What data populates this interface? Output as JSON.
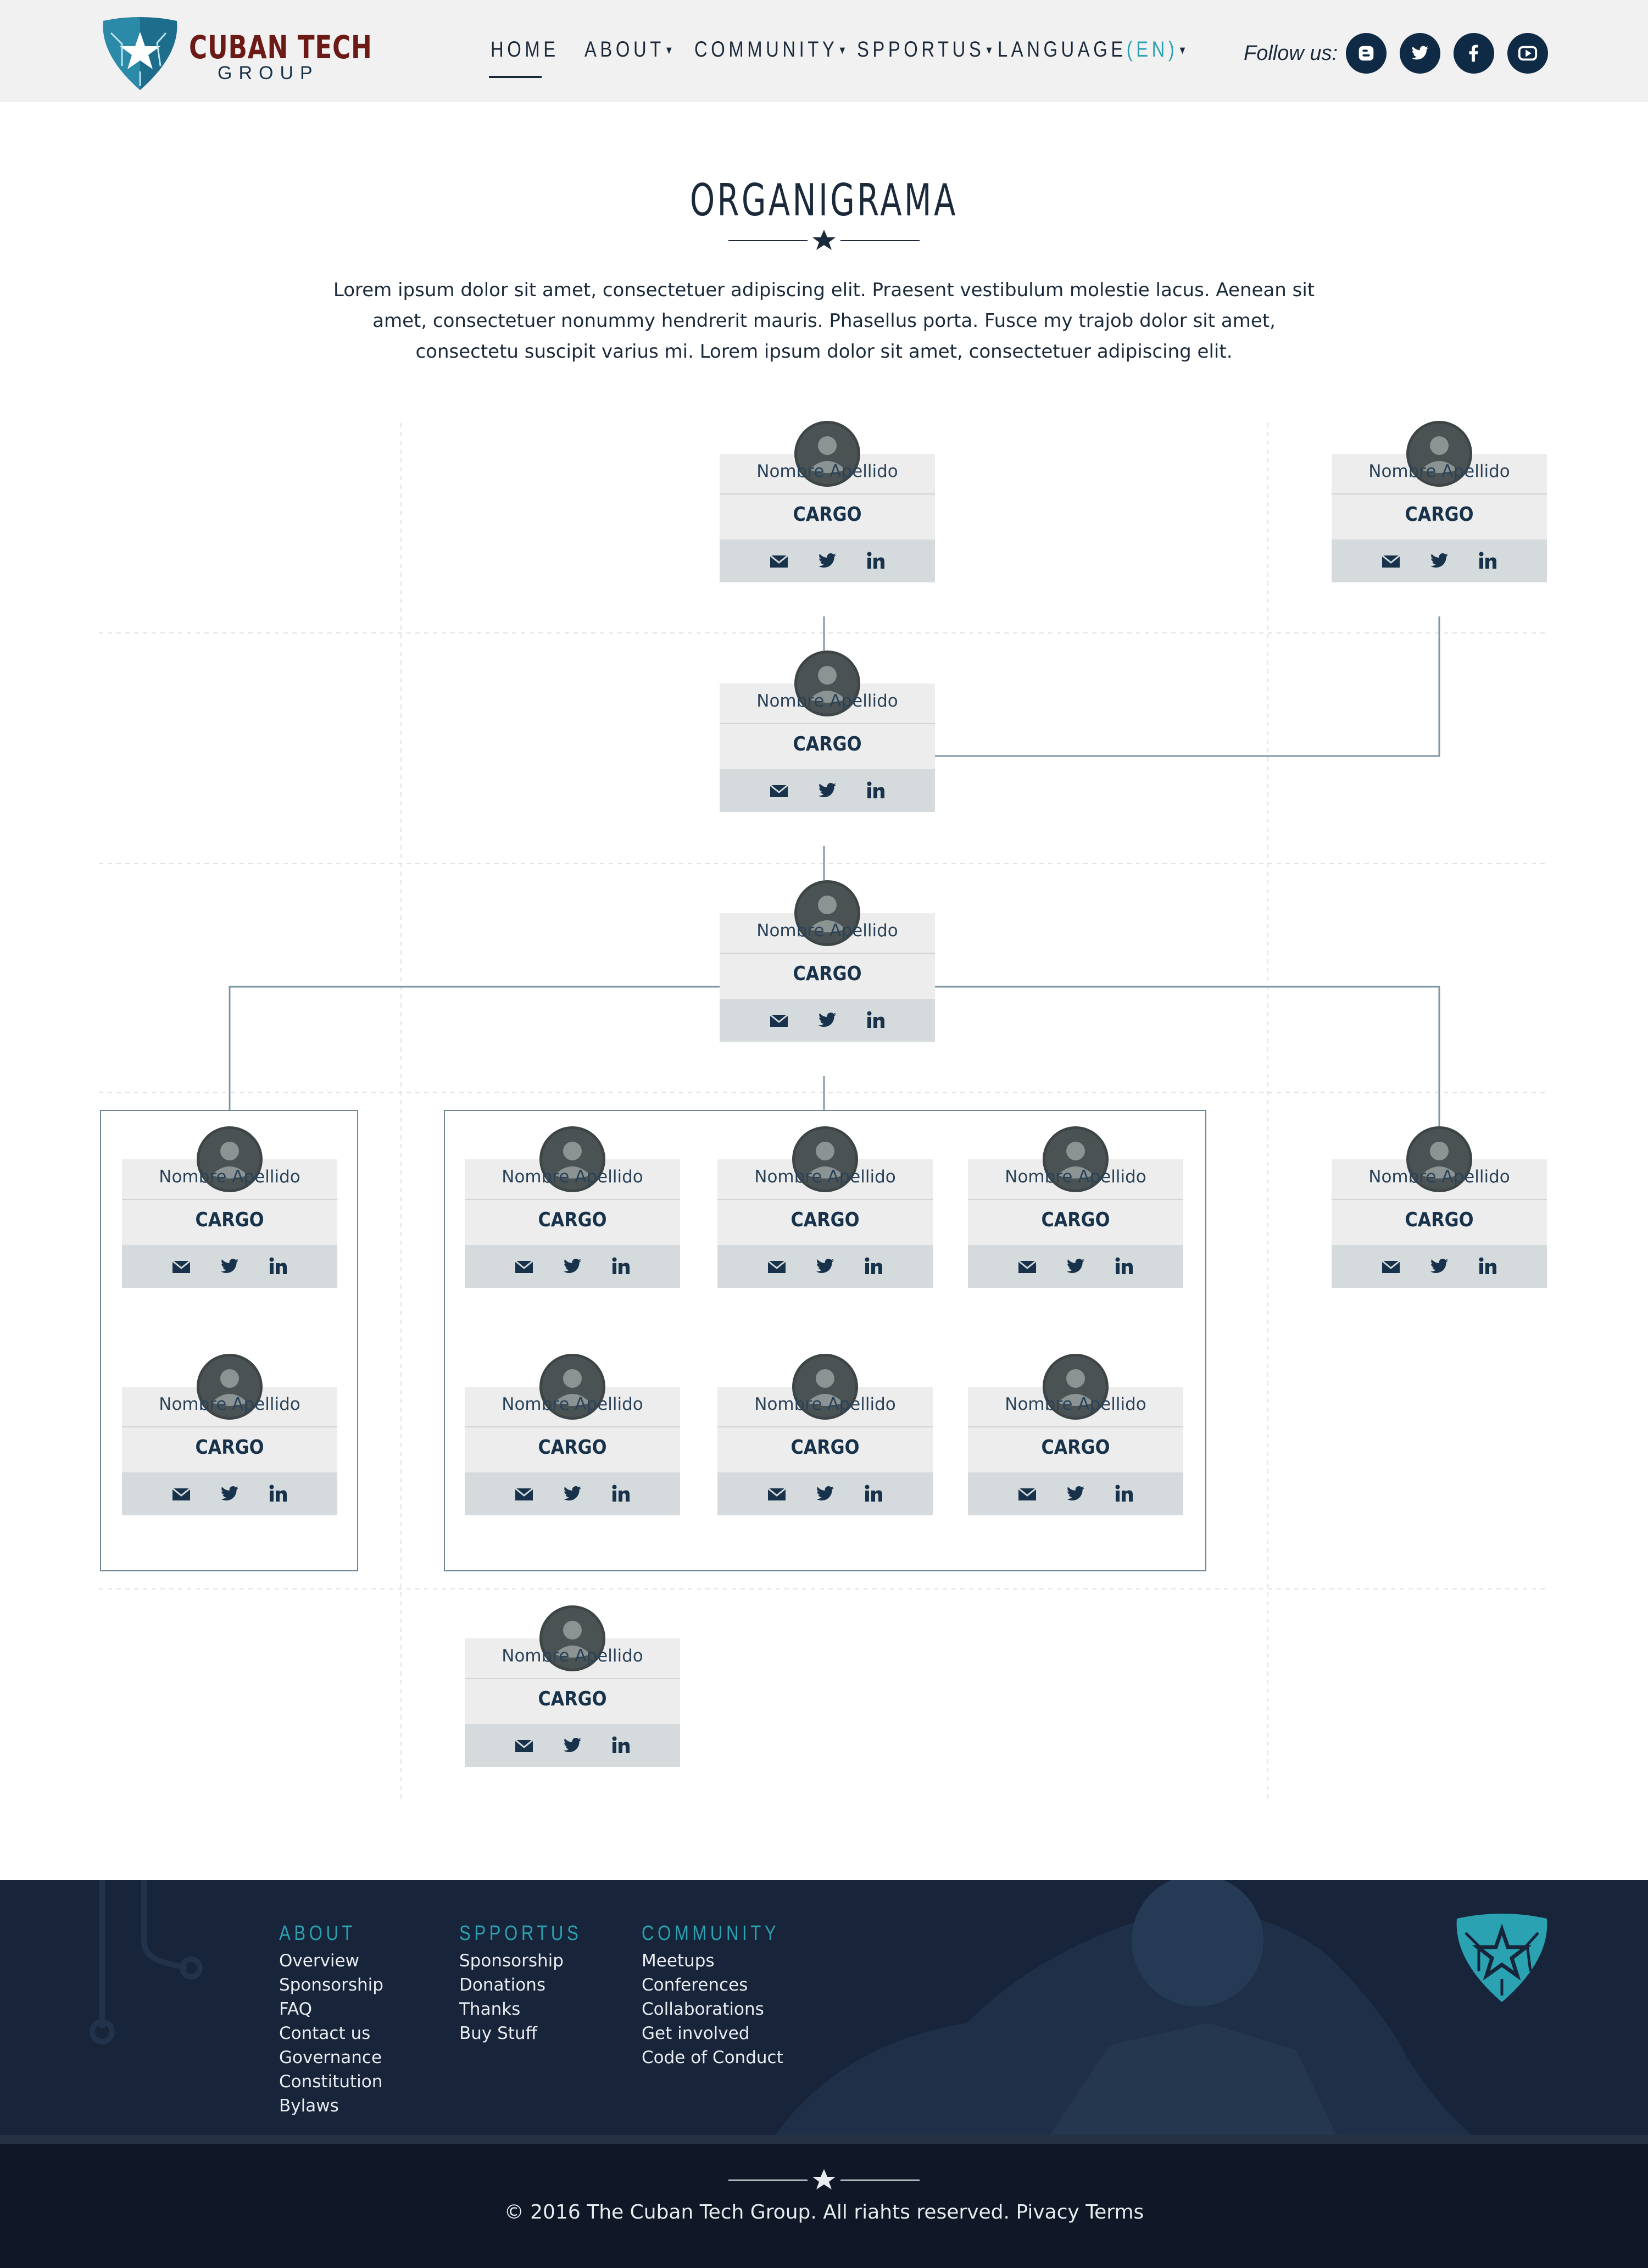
{
  "brand": {
    "name": "CUBAN TECH",
    "sub": "GROUP",
    "colors": {
      "navy": "#0f2a44",
      "teal": "#2aa2b2",
      "maroon": "#6b1a16",
      "footer": "#17243a"
    }
  },
  "nav": {
    "items": [
      {
        "label": "HOME",
        "active": true
      },
      {
        "label": "ABOUT",
        "dropdown": true
      },
      {
        "label": "COMMUNITY",
        "dropdown": true
      },
      {
        "label": "SPPORTUS",
        "dropdown": true
      }
    ],
    "language": {
      "label": "LANGUAGE",
      "code": "(EN)",
      "dropdown": true
    },
    "follow_label": "Follow us:",
    "social": [
      "blogger-icon",
      "twitter-icon",
      "facebook-icon",
      "youtube-icon"
    ]
  },
  "page": {
    "title": "ORGANIGRAMA",
    "intro": "Lorem ipsum dolor sit amet, consectetuer adipiscing elit. Praesent vestibulum molestie lacus. Aenean sit amet, consectetuer nonummy hendrerit  mauris. Phasellus porta. Fusce my trajob dolor sit amet, consectetu suscipit varius mi. Lorem ipsum dolor sit amet, consectetuer adipiscing elit."
  },
  "org": {
    "members": [
      {
        "name": "Nombre Apellido",
        "role": "CARGO"
      },
      {
        "name": "Nombre Apellido",
        "role": "CARGO"
      },
      {
        "name": "Nombre Apellido",
        "role": "CARGO"
      },
      {
        "name": "Nombre Apellido",
        "role": "CARGO"
      },
      {
        "name": "Nombre Apellido",
        "role": "CARGO"
      },
      {
        "name": "Nombre Apellido",
        "role": "CARGO"
      },
      {
        "name": "Nombre Apellido",
        "role": "CARGO"
      },
      {
        "name": "Nombre Apellido",
        "role": "CARGO"
      },
      {
        "name": "Nombre Apellido",
        "role": "CARGO"
      },
      {
        "name": "Nombre Apellido",
        "role": "CARGO"
      },
      {
        "name": "Nombre Apellido",
        "role": "CARGO"
      },
      {
        "name": "Nombre Apellido",
        "role": "CARGO"
      },
      {
        "name": "Nombre Apellido",
        "role": "CARGO"
      },
      {
        "name": "Nombre Apellido",
        "role": "CARGO"
      }
    ],
    "card_icons": [
      "mail-icon",
      "twitter-icon",
      "linkedin-icon"
    ]
  },
  "footer": {
    "columns": [
      {
        "title": "ABOUT",
        "links": [
          "Overview",
          "Sponsorship",
          "FAQ",
          "Contact us",
          "Governance",
          "Constitution",
          "Bylaws"
        ]
      },
      {
        "title": "SPPORTUS",
        "links": [
          "Sponsorship",
          "Donations",
          "Thanks",
          "Buy Stuff"
        ]
      },
      {
        "title": "COMMUNITY",
        "links": [
          "Meetups",
          "Conferences",
          "Collaborations",
          "Get involved",
          "Code of Conduct"
        ]
      }
    ],
    "copyright": "© 2016 The Cuban Tech Group. All riahts reserved.",
    "privacy": "Pivacy",
    "terms": "Terms"
  }
}
